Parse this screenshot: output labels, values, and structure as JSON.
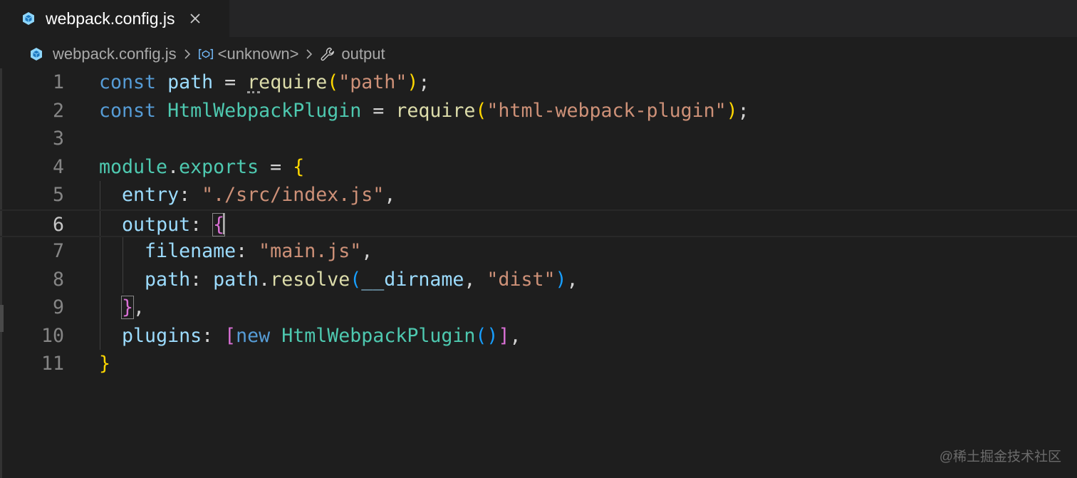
{
  "tab": {
    "label": "webpack.config.js",
    "icon": "webpack-file-icon",
    "close_icon": "close-icon"
  },
  "breadcrumb": {
    "file": "webpack.config.js",
    "symbol1": "<unknown>",
    "symbol2": "output"
  },
  "editor": {
    "current_line": 6,
    "lines": [
      {
        "n": "1",
        "tokens": [
          [
            "kw",
            "const"
          ],
          [
            "plain",
            " "
          ],
          [
            "var",
            "path"
          ],
          [
            "plain",
            " = "
          ],
          [
            "fn",
            "require"
          ],
          [
            "p1",
            "("
          ],
          [
            "str",
            "\"path\""
          ],
          [
            "p1",
            ")"
          ],
          [
            "plain",
            ";"
          ]
        ]
      },
      {
        "n": "2",
        "tokens": [
          [
            "kw",
            "const"
          ],
          [
            "plain",
            " "
          ],
          [
            "cls",
            "HtmlWebpackPlugin"
          ],
          [
            "plain",
            " = "
          ],
          [
            "fn",
            "require"
          ],
          [
            "p1",
            "("
          ],
          [
            "str",
            "\"html-webpack-plugin\""
          ],
          [
            "p1",
            ")"
          ],
          [
            "plain",
            ";"
          ]
        ]
      },
      {
        "n": "3",
        "tokens": []
      },
      {
        "n": "4",
        "tokens": [
          [
            "cls",
            "module"
          ],
          [
            "plain",
            "."
          ],
          [
            "cls",
            "exports"
          ],
          [
            "plain",
            " = "
          ],
          [
            "p1",
            "{"
          ]
        ]
      },
      {
        "n": "5",
        "tokens": [
          [
            "plain",
            "  "
          ],
          [
            "prop",
            "entry"
          ],
          [
            "plain",
            ": "
          ],
          [
            "str",
            "\"./src/index.js\""
          ],
          [
            "plain",
            ","
          ]
        ]
      },
      {
        "n": "6",
        "tokens": [
          [
            "plain",
            "  "
          ],
          [
            "prop",
            "output"
          ],
          [
            "plain",
            ": "
          ],
          [
            "p2",
            "{"
          ]
        ]
      },
      {
        "n": "7",
        "tokens": [
          [
            "plain",
            "    "
          ],
          [
            "prop",
            "filename"
          ],
          [
            "plain",
            ": "
          ],
          [
            "str",
            "\"main.js\""
          ],
          [
            "plain",
            ","
          ]
        ]
      },
      {
        "n": "8",
        "tokens": [
          [
            "plain",
            "    "
          ],
          [
            "prop",
            "path"
          ],
          [
            "plain",
            ": "
          ],
          [
            "var",
            "path"
          ],
          [
            "plain",
            "."
          ],
          [
            "fn",
            "resolve"
          ],
          [
            "p3",
            "("
          ],
          [
            "var",
            "__dirname"
          ],
          [
            "plain",
            ", "
          ],
          [
            "str",
            "\"dist\""
          ],
          [
            "p3",
            ")"
          ],
          [
            "plain",
            ","
          ]
        ]
      },
      {
        "n": "9",
        "tokens": [
          [
            "plain",
            "  "
          ],
          [
            "p2",
            "}"
          ],
          [
            "plain",
            ","
          ]
        ]
      },
      {
        "n": "10",
        "tokens": [
          [
            "plain",
            "  "
          ],
          [
            "prop",
            "plugins"
          ],
          [
            "plain",
            ": "
          ],
          [
            "p2",
            "["
          ],
          [
            "kw",
            "new"
          ],
          [
            "plain",
            " "
          ],
          [
            "cls",
            "HtmlWebpackPlugin"
          ],
          [
            "p3",
            "()"
          ],
          [
            "p2",
            "]"
          ],
          [
            "plain",
            ","
          ]
        ]
      },
      {
        "n": "11",
        "tokens": [
          [
            "p1",
            "}"
          ]
        ]
      }
    ]
  },
  "watermark": "@稀土掘金技术社区"
}
